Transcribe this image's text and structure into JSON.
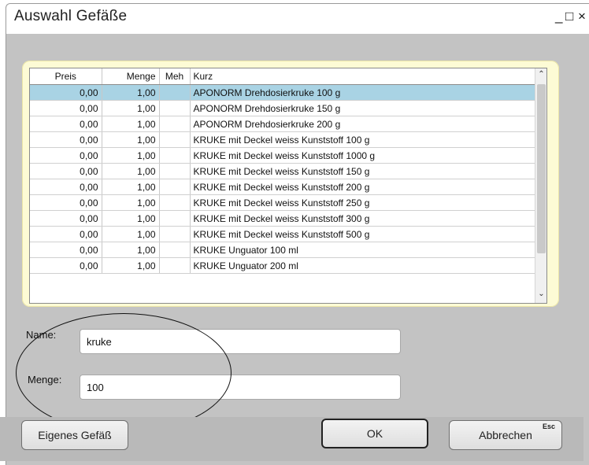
{
  "window": {
    "title": "Auswahl Gefäße",
    "controls": {
      "minimize": "_",
      "maximize": "□",
      "close": "×"
    }
  },
  "table": {
    "headers": {
      "preis": "Preis",
      "menge": "Menge",
      "meh": "Meh",
      "kurz": "Kurz"
    },
    "rows": [
      {
        "preis": "0,00",
        "menge": "1,00",
        "meh": "",
        "kurz": "APONORM Drehdosierkruke 100 g"
      },
      {
        "preis": "0,00",
        "menge": "1,00",
        "meh": "",
        "kurz": "APONORM Drehdosierkruke 150 g"
      },
      {
        "preis": "0,00",
        "menge": "1,00",
        "meh": "",
        "kurz": "APONORM Drehdosierkruke 200 g"
      },
      {
        "preis": "0,00",
        "menge": "1,00",
        "meh": "",
        "kurz": "KRUKE mit Deckel weiss Kunststoff 100 g"
      },
      {
        "preis": "0,00",
        "menge": "1,00",
        "meh": "",
        "kurz": "KRUKE mit Deckel weiss Kunststoff 1000 g"
      },
      {
        "preis": "0,00",
        "menge": "1,00",
        "meh": "",
        "kurz": "KRUKE mit Deckel weiss Kunststoff 150 g"
      },
      {
        "preis": "0,00",
        "menge": "1,00",
        "meh": "",
        "kurz": "KRUKE mit Deckel weiss Kunststoff 200 g"
      },
      {
        "preis": "0,00",
        "menge": "1,00",
        "meh": "",
        "kurz": "KRUKE mit Deckel weiss Kunststoff 250 g"
      },
      {
        "preis": "0,00",
        "menge": "1,00",
        "meh": "",
        "kurz": "KRUKE mit Deckel weiss Kunststoff 300 g"
      },
      {
        "preis": "0,00",
        "menge": "1,00",
        "meh": "",
        "kurz": "KRUKE mit Deckel weiss Kunststoff 500 g"
      },
      {
        "preis": "0,00",
        "menge": "1,00",
        "meh": "",
        "kurz": "KRUKE Unguator 100 ml"
      },
      {
        "preis": "0,00",
        "menge": "1,00",
        "meh": "",
        "kurz": "KRUKE Unguator 200 ml"
      }
    ],
    "selected_row_index": 0,
    "scrollbar": {
      "up_icon": "chevron-up-icon",
      "down_icon": "chevron-down-icon",
      "up_glyph": "⌃",
      "down_glyph": "⌄"
    }
  },
  "form": {
    "name_label": "Name:",
    "name_value": "kruke",
    "menge_label": "Menge:",
    "menge_value": "100"
  },
  "buttons": {
    "own_container": "Eigenes Gefäß",
    "ok": "OK",
    "cancel": "Abbrechen",
    "cancel_shortcut": "Esc"
  },
  "colors": {
    "window_bg": "#c3c3c3",
    "panel_bg": "#fdfbd5",
    "selected_row": "#a9d3e4"
  }
}
